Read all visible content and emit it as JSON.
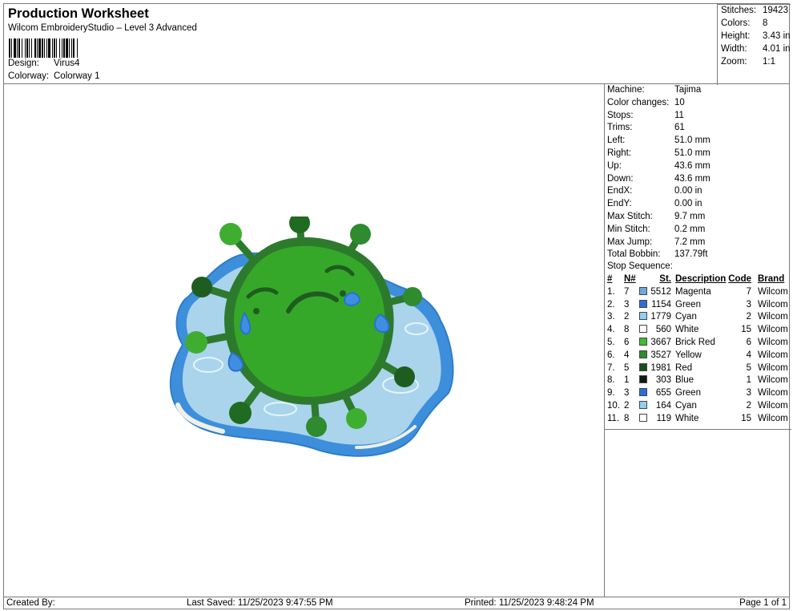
{
  "header": {
    "title": "Production Worksheet",
    "subtitle": "Wilcom EmbroideryStudio – Level 3 Advanced",
    "design_label": "Design:",
    "design_value": "Virus4",
    "colorway_label": "Colorway:",
    "colorway_value": "Colorway 1"
  },
  "summary": [
    {
      "label": "Stitches:",
      "value": "19423"
    },
    {
      "label": "Colors:",
      "value": "8"
    },
    {
      "label": "Height:",
      "value": "3.43 in"
    },
    {
      "label": "Width:",
      "value": "4.01 in"
    },
    {
      "label": "Zoom:",
      "value": "1:1"
    }
  ],
  "machine_info": [
    {
      "label": "Machine:",
      "value": "Tajima"
    },
    {
      "label": "Color changes:",
      "value": "10"
    },
    {
      "label": "Stops:",
      "value": "11"
    },
    {
      "label": "Trims:",
      "value": "61"
    },
    {
      "label": "Left:",
      "value": "51.0 mm"
    },
    {
      "label": "Right:",
      "value": "51.0 mm"
    },
    {
      "label": "Up:",
      "value": "43.6 mm"
    },
    {
      "label": "Down:",
      "value": "43.6 mm"
    },
    {
      "label": "EndX:",
      "value": "0.00 in"
    },
    {
      "label": "EndY:",
      "value": "0.00 in"
    },
    {
      "label": "Max Stitch:",
      "value": "9.7 mm"
    },
    {
      "label": "Min Stitch:",
      "value": "0.2 mm"
    },
    {
      "label": "Max Jump:",
      "value": "7.2 mm"
    },
    {
      "label": "Total Bobbin:",
      "value": "137.79ft"
    }
  ],
  "stop_sequence": {
    "label": "Stop Sequence:",
    "headers": {
      "num": "#",
      "n": "N#",
      "st": "St.",
      "desc": "Description",
      "code": "Code",
      "brand": "Brand"
    },
    "rows": [
      {
        "num": "1.",
        "n": "7",
        "color": "#6fa8dc",
        "st": "5512",
        "desc": "Magenta",
        "code": "7",
        "brand": "Wilcom"
      },
      {
        "num": "2.",
        "n": "3",
        "color": "#2a6fd6",
        "st": "1154",
        "desc": "Green",
        "code": "3",
        "brand": "Wilcom"
      },
      {
        "num": "3.",
        "n": "2",
        "color": "#8fd0f2",
        "st": "1779",
        "desc": "Cyan",
        "code": "2",
        "brand": "Wilcom"
      },
      {
        "num": "4.",
        "n": "8",
        "color": "#ffffff",
        "st": "560",
        "desc": "White",
        "code": "15",
        "brand": "Wilcom"
      },
      {
        "num": "5.",
        "n": "6",
        "color": "#3dbd2f",
        "st": "3667",
        "desc": "Brick Red",
        "code": "6",
        "brand": "Wilcom"
      },
      {
        "num": "6.",
        "n": "4",
        "color": "#2e8b2e",
        "st": "3527",
        "desc": "Yellow",
        "code": "4",
        "brand": "Wilcom"
      },
      {
        "num": "7.",
        "n": "5",
        "color": "#1b4d1b",
        "st": "1981",
        "desc": "Red",
        "code": "5",
        "brand": "Wilcom"
      },
      {
        "num": "8.",
        "n": "1",
        "color": "#0d1a0d",
        "st": "303",
        "desc": "Blue",
        "code": "1",
        "brand": "Wilcom"
      },
      {
        "num": "9.",
        "n": "3",
        "color": "#2a6fd6",
        "st": "655",
        "desc": "Green",
        "code": "3",
        "brand": "Wilcom"
      },
      {
        "num": "10.",
        "n": "2",
        "color": "#8fd0f2",
        "st": "164",
        "desc": "Cyan",
        "code": "2",
        "brand": "Wilcom"
      },
      {
        "num": "11.",
        "n": "8",
        "color": "#ffffff",
        "st": "119",
        "desc": "White",
        "code": "15",
        "brand": "Wilcom"
      }
    ]
  },
  "footer": {
    "created_by": "Created By:",
    "last_saved": "Last Saved: 11/25/2023 9:47:55 PM",
    "printed": "Printed: 11/25/2023 9:48:24 PM",
    "page": "Page 1 of 1"
  },
  "colors": {
    "puddle_outer": "#3d8fdc",
    "puddle_inner": "#a9d4ec",
    "virus_body": "#35a82a",
    "virus_dark": "#1f6b22",
    "virus_outline": "#2d7a2d",
    "tear": "#3f8fe0"
  }
}
